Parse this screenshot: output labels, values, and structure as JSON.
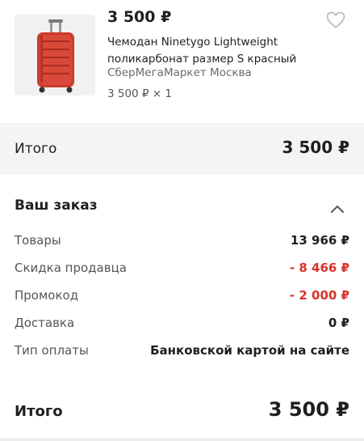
{
  "product": {
    "price": "3 500 ₽",
    "title": "Чемодан Ninetygo Lightweight поликарбонат размер S красный",
    "seller": "СберМегаМаркет Москва",
    "quantity": "3 500 ₽ × 1",
    "image_icon": "red-suitcase-image",
    "favorite_icon": "heart-outline-icon",
    "colors": {
      "suitcase": "#cc3b2b",
      "favorite": "#bdbdbd"
    }
  },
  "summary": {
    "label": "Итого",
    "value": "3 500 ₽"
  },
  "order": {
    "heading": "Ваш заказ",
    "toggle_icon": "chevron-up-icon",
    "rows": [
      {
        "label": "Товары",
        "value": "13 966 ₽"
      },
      {
        "label": "Скидка продавца",
        "value": "- 8 466 ₽"
      },
      {
        "label": "Промокод",
        "value": "- 2 000 ₽"
      },
      {
        "label": "Доставка",
        "value": "0 ₽"
      },
      {
        "label": "Тип оплаты",
        "value": "Банковской картой на сайте"
      }
    ],
    "total_label": "Итого",
    "total_value": "3 500 ₽",
    "colors": {
      "discount": "#d8322a",
      "text": "#1f1f1f",
      "muted": "#555555"
    }
  }
}
